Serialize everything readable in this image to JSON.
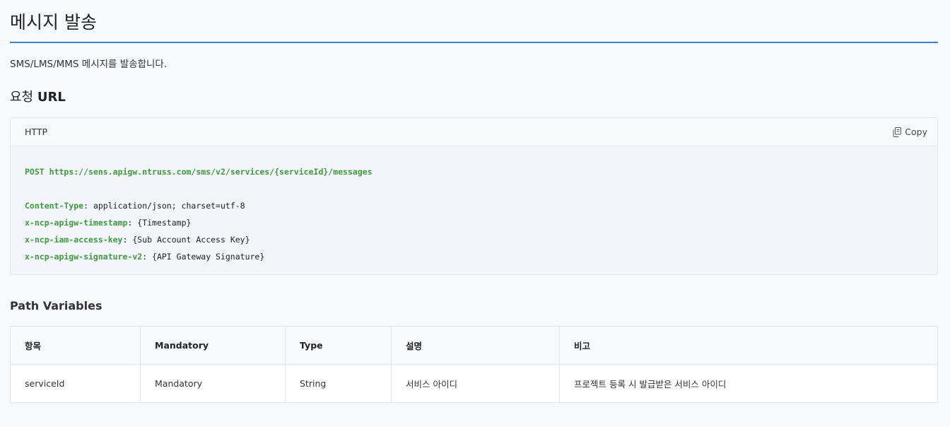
{
  "page": {
    "title": "메시지 발송",
    "description": "SMS/LMS/MMS 메시지를 발송합니다."
  },
  "request_url": {
    "title_prefix": "요청",
    "title_strong": "URL",
    "code_label": "HTTP",
    "copy_label": "Copy",
    "method": "POST",
    "url": "https://sens.apigw.ntruss.com/sms/v2/services/{serviceId}/messages",
    "headers": [
      {
        "name": "Content-Type",
        "value": "application/json; charset=utf-8"
      },
      {
        "name": "x-ncp-apigw-timestamp",
        "value": "{Timestamp}"
      },
      {
        "name": "x-ncp-iam-access-key",
        "value": "{Sub Account Access Key}"
      },
      {
        "name": "x-ncp-apigw-signature-v2",
        "value": "{API Gateway Signature}"
      }
    ]
  },
  "path_variables": {
    "title": "Path Variables",
    "columns": [
      "항목",
      "Mandatory",
      "Type",
      "설명",
      "비고"
    ],
    "rows": [
      [
        "serviceId",
        "Mandatory",
        "String",
        "서비스 아이디",
        "프로젝트 등록 시 발급받은 서비스 아이디"
      ]
    ]
  },
  "colors": {
    "accent_rule": "#3a83c5",
    "code_keyword": "#3d9a3d"
  }
}
